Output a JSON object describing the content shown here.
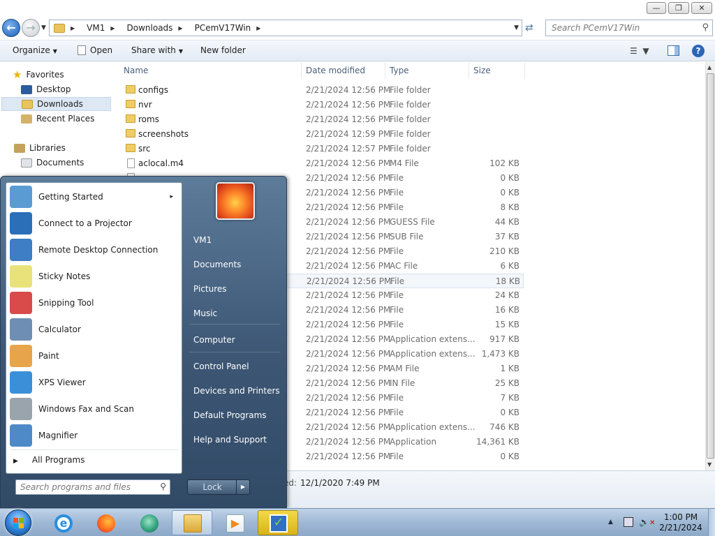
{
  "explorer": {
    "window_controls": {
      "minimize": "—",
      "restore": "❐",
      "close": "✕"
    },
    "breadcrumbs": [
      "VM1",
      "Downloads",
      "PCemV17Win"
    ],
    "search_placeholder": "Search PCemV17Win",
    "toolbar": {
      "organize": "Organize",
      "open": "Open",
      "share_with": "Share with",
      "new_folder": "New folder"
    },
    "nav": {
      "favorites": "Favorites",
      "desktop": "Desktop",
      "downloads": "Downloads",
      "recent": "Recent Places",
      "libraries": "Libraries",
      "documents": "Documents"
    },
    "columns": {
      "name": "Name",
      "date": "Date modified",
      "type": "Type",
      "size": "Size"
    },
    "rows": [
      {
        "name": "configs",
        "date": "2/21/2024 12:56 PM",
        "type": "File folder",
        "size": "",
        "icon": "folder-icon"
      },
      {
        "name": "nvr",
        "date": "2/21/2024 12:56 PM",
        "type": "File folder",
        "size": "",
        "icon": "folder-icon"
      },
      {
        "name": "roms",
        "date": "2/21/2024 12:56 PM",
        "type": "File folder",
        "size": "",
        "icon": "folder-icon"
      },
      {
        "name": "screenshots",
        "date": "2/21/2024 12:59 PM",
        "type": "File folder",
        "size": "",
        "icon": "folder-icon"
      },
      {
        "name": "src",
        "date": "2/21/2024 12:57 PM",
        "type": "File folder",
        "size": "",
        "icon": "folder-icon"
      },
      {
        "name": "aclocal.m4",
        "date": "2/21/2024 12:56 PM",
        "type": "M4 File",
        "size": "102 KB",
        "icon": "file-icon"
      },
      {
        "name": "",
        "date": "2/21/2024 12:56 PM",
        "type": "File",
        "size": "0 KB",
        "icon": "file-icon"
      },
      {
        "name": "",
        "date": "2/21/2024 12:56 PM",
        "type": "File",
        "size": "0 KB",
        "icon": "file-icon"
      },
      {
        "name": "",
        "date": "2/21/2024 12:56 PM",
        "type": "File",
        "size": "8 KB",
        "icon": "file-icon"
      },
      {
        "name": "",
        "date": "2/21/2024 12:56 PM",
        "type": "GUESS File",
        "size": "44 KB",
        "icon": "file-icon"
      },
      {
        "name": "",
        "date": "2/21/2024 12:56 PM",
        "type": "SUB File",
        "size": "37 KB",
        "icon": "file-icon"
      },
      {
        "name": "",
        "date": "2/21/2024 12:56 PM",
        "type": "File",
        "size": "210 KB",
        "icon": "file-icon"
      },
      {
        "name": "",
        "date": "2/21/2024 12:56 PM",
        "type": "AC File",
        "size": "6 KB",
        "icon": "file-icon"
      },
      {
        "name": "",
        "date": "2/21/2024 12:56 PM",
        "type": "File",
        "size": "18 KB",
        "icon": "file-icon"
      },
      {
        "name": "",
        "date": "2/21/2024 12:56 PM",
        "type": "File",
        "size": "24 KB",
        "icon": "file-icon"
      },
      {
        "name": "",
        "date": "2/21/2024 12:56 PM",
        "type": "File",
        "size": "16 KB",
        "icon": "file-icon"
      },
      {
        "name": "",
        "date": "2/21/2024 12:56 PM",
        "type": "File",
        "size": "15 KB",
        "icon": "file-icon"
      },
      {
        "name": "",
        "date": "2/21/2024 12:56 PM",
        "type": "Application extens...",
        "size": "917 KB",
        "icon": "file-icon"
      },
      {
        "name": "",
        "date": "2/21/2024 12:56 PM",
        "type": "Application extens...",
        "size": "1,473 KB",
        "icon": "file-icon"
      },
      {
        "name": "",
        "date": "2/21/2024 12:56 PM",
        "type": "AM File",
        "size": "1 KB",
        "icon": "file-icon"
      },
      {
        "name": "",
        "date": "2/21/2024 12:56 PM",
        "type": "IN File",
        "size": "25 KB",
        "icon": "file-icon"
      },
      {
        "name": "",
        "date": "2/21/2024 12:56 PM",
        "type": "File",
        "size": "7 KB",
        "icon": "file-icon"
      },
      {
        "name": "",
        "date": "2/21/2024 12:56 PM",
        "type": "File",
        "size": "0 KB",
        "icon": "file-icon"
      },
      {
        "name": "",
        "date": "2/21/2024 12:56 PM",
        "type": "Application extens...",
        "size": "746 KB",
        "icon": "file-icon"
      },
      {
        "name": "",
        "date": "2/21/2024 12:56 PM",
        "type": "Application",
        "size": "14,361 KB",
        "icon": "file-icon"
      },
      {
        "name": "",
        "date": "2/21/2024 12:56 PM",
        "type": "File",
        "size": "0 KB",
        "icon": "file-icon"
      }
    ],
    "details_label": "ed:",
    "details_value": "12/1/2020 7:49 PM"
  },
  "start_menu": {
    "programs": [
      {
        "label": "Getting Started",
        "icon": "getting-started-icon",
        "submenu": "▸",
        "color": "#5a9bd4"
      },
      {
        "label": "Connect to a Projector",
        "icon": "projector-icon",
        "submenu": "",
        "color": "#2a6fb8"
      },
      {
        "label": "Remote Desktop Connection",
        "icon": "remote-desktop-icon",
        "submenu": "",
        "color": "#3d7ec4"
      },
      {
        "label": "Sticky Notes",
        "icon": "sticky-notes-icon",
        "submenu": "",
        "color": "#e9e27a"
      },
      {
        "label": "Snipping Tool",
        "icon": "scissors-icon",
        "submenu": "",
        "color": "#d94a4a"
      },
      {
        "label": "Calculator",
        "icon": "calculator-icon",
        "submenu": "",
        "color": "#6e8fb3"
      },
      {
        "label": "Paint",
        "icon": "paint-icon",
        "submenu": "",
        "color": "#e8a44a"
      },
      {
        "label": "XPS Viewer",
        "icon": "xps-viewer-icon",
        "submenu": "",
        "color": "#3b8fd9"
      },
      {
        "label": "Windows Fax and Scan",
        "icon": "fax-scan-icon",
        "submenu": "",
        "color": "#9aa4ad"
      },
      {
        "label": "Magnifier",
        "icon": "magnifier-icon",
        "submenu": "",
        "color": "#4d8ac7"
      }
    ],
    "all_programs": "All Programs",
    "search_placeholder": "Search programs and files",
    "right_items": [
      "VM1",
      "Documents",
      "Pictures",
      "Music",
      "Computer",
      "Control Panel",
      "Devices and Printers",
      "Default Programs",
      "Help and Support"
    ],
    "lock": "Lock"
  },
  "taskbar": {
    "time": "1:00 PM",
    "date": "2/21/2024"
  }
}
